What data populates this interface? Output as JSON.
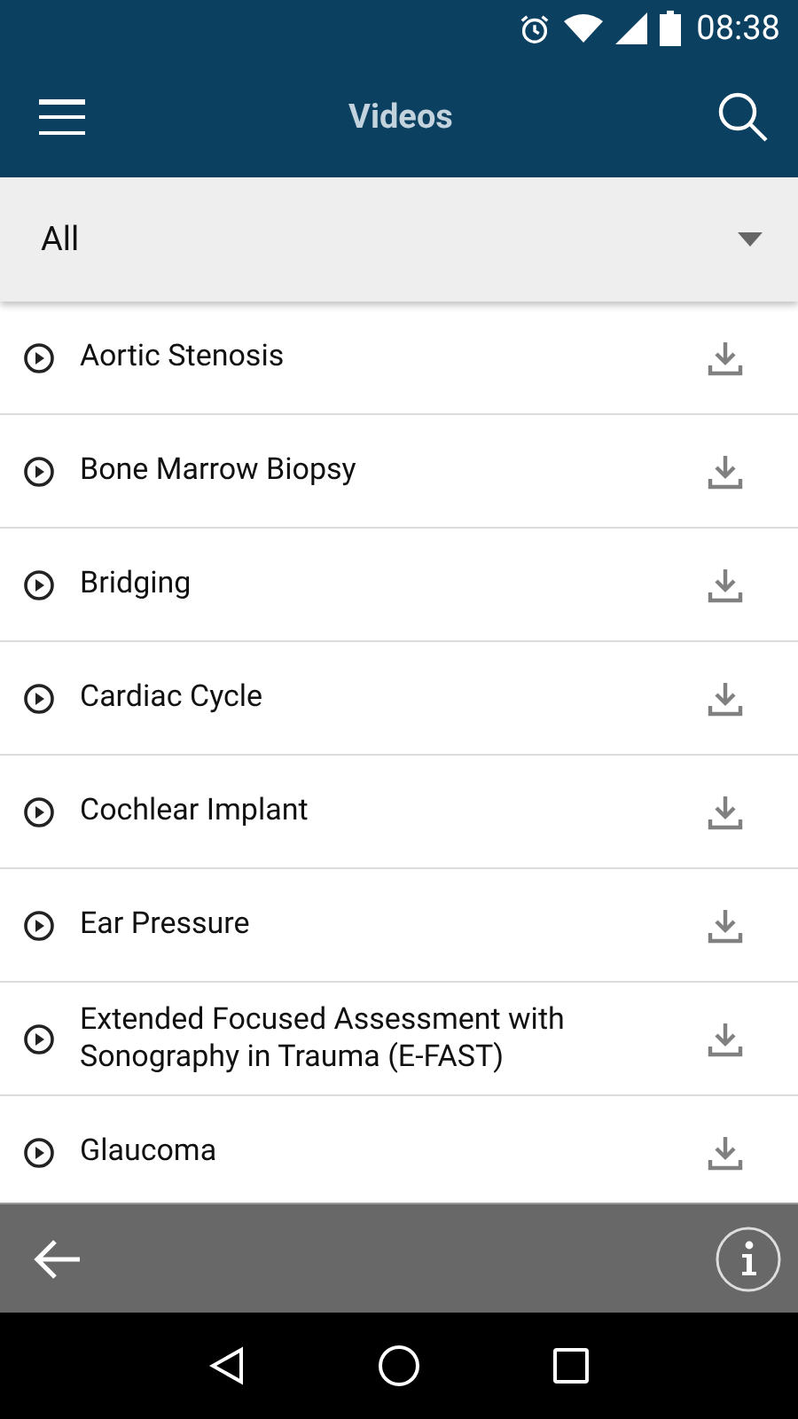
{
  "status_bar": {
    "time": "08:38"
  },
  "app_bar": {
    "title": "Videos"
  },
  "filter": {
    "value": "All"
  },
  "videos": [
    {
      "title": "Aortic Stenosis"
    },
    {
      "title": "Bone Marrow Biopsy"
    },
    {
      "title": "Bridging"
    },
    {
      "title": "Cardiac Cycle"
    },
    {
      "title": "Cochlear Implant"
    },
    {
      "title": "Ear Pressure"
    },
    {
      "title": "Extended Focused Assessment with Sonography in Trauma (E-FAST)"
    },
    {
      "title": "Glaucoma"
    }
  ]
}
